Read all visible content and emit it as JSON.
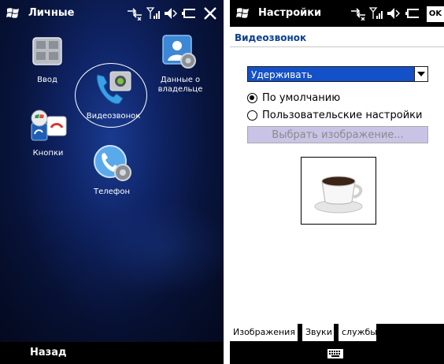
{
  "left": {
    "title": "Личные",
    "icons": [
      {
        "label": "Ввод"
      },
      {
        "label": "Данные о владельце"
      },
      {
        "label": "Видеозвонок"
      },
      {
        "label": "Кнопки"
      },
      {
        "label": "Телефон"
      }
    ],
    "bottom_label": "Назад"
  },
  "right": {
    "title": "Настройки",
    "ok_label": "OK",
    "subheader": "Видеозвонок",
    "dropdown_value": "Удерживать",
    "radio_default": "По умолчанию",
    "radio_custom": "Пользовательские настройки",
    "choose_image": "Выбрать изображение...",
    "tabs": [
      "Изображения",
      "Звуки",
      "службы"
    ]
  },
  "colors": {
    "accent_blue": "#1451c8",
    "subheader_text": "#0a3f93",
    "disabled_button": "#c9c4e6"
  }
}
